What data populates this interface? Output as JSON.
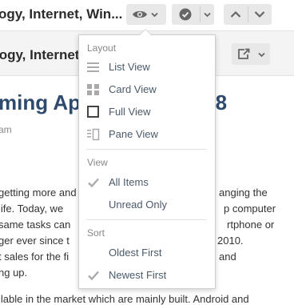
{
  "toolbar": {
    "feed_title": "ogy, Internet, Win...",
    "view_icon": "eye-icon",
    "check_icon": "check-circle-icon",
    "up_icon": "chevron-up-icon",
    "down_icon": "chevron-down-icon"
  },
  "subbar": {
    "title": "logy, Internet, Win...",
    "share_icon": "share-icon"
  },
  "article": {
    "title_left": "ming App",
    "title_right": "s 8",
    "byline": "am",
    "lines": [
      {
        "left": "getting more and",
        "right": "anging the"
      },
      {
        "left": " life. Today, we",
        "right": "p computer"
      },
      {
        "left": "same tasks can",
        "right": "rtphone or"
      },
      {
        "left": "ger ever since t",
        "right": "2010."
      },
      {
        "left": "t sales for the fi",
        "right": "and"
      },
      {
        "left": "ng up.",
        "right": ""
      },
      {
        "left": "ilable in the market which are mainly built. Android and",
        "right": ""
      }
    ]
  },
  "menu": {
    "layout_header": "Layout",
    "layout_items": [
      {
        "label": "List View",
        "icon": "list-view-icon"
      },
      {
        "label": "Card View",
        "icon": "card-view-icon"
      },
      {
        "label": "Full View",
        "icon": "full-view-icon"
      },
      {
        "label": "Pane View",
        "icon": "pane-view-icon"
      }
    ],
    "view_header": "View",
    "view_items": [
      {
        "label": "All Items",
        "checked": true
      },
      {
        "label": "Unread Only",
        "checked": false
      }
    ],
    "sort_header": "Sort",
    "sort_items": [
      {
        "label": "Oldest First",
        "checked": false
      },
      {
        "label": "Newest First",
        "checked": true
      }
    ]
  }
}
